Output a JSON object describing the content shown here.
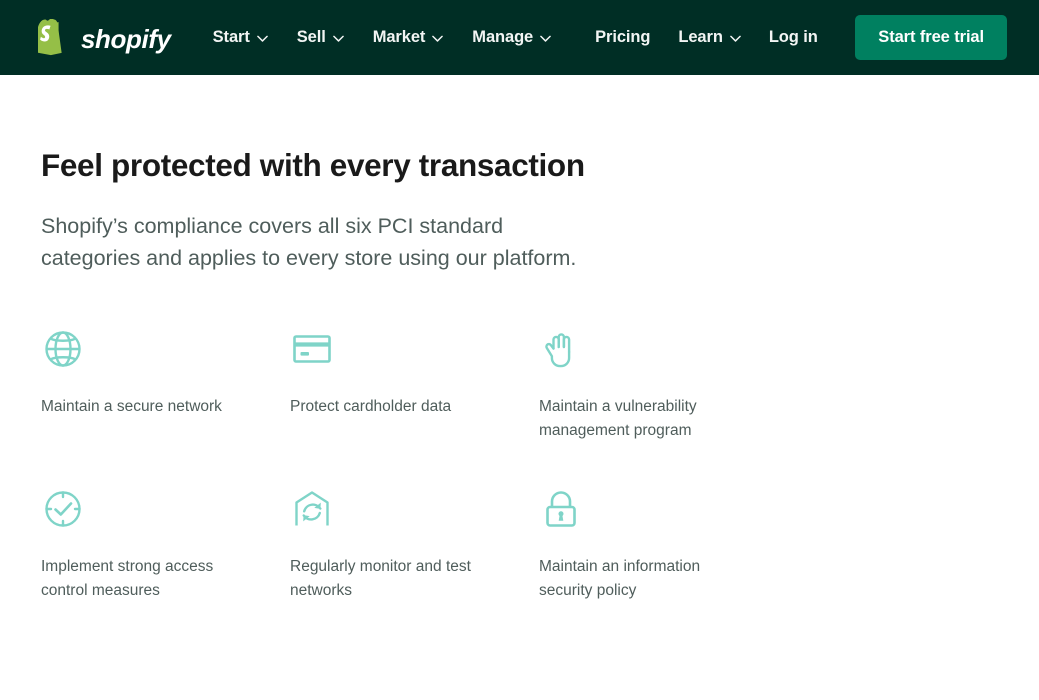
{
  "header": {
    "brand": {
      "name": "shopify",
      "logo_icon": "shopify-bag-icon"
    },
    "primary_nav": [
      {
        "label": "Start",
        "icon": "chevron-down-icon",
        "has_dropdown": true
      },
      {
        "label": "Sell",
        "icon": "chevron-down-icon",
        "has_dropdown": true
      },
      {
        "label": "Market",
        "icon": "chevron-down-icon",
        "has_dropdown": true
      },
      {
        "label": "Manage",
        "icon": "chevron-down-icon",
        "has_dropdown": true
      }
    ],
    "secondary_nav": [
      {
        "label": "Pricing",
        "has_dropdown": false
      },
      {
        "label": "Learn",
        "icon": "chevron-down-icon",
        "has_dropdown": true
      },
      {
        "label": "Log in",
        "has_dropdown": false
      }
    ],
    "cta_label": "Start free trial",
    "colors": {
      "background": "#002e25",
      "cta_background": "#008060",
      "text": "#f2f5f4"
    }
  },
  "main": {
    "headline": "Feel protected with every transaction",
    "lede": "Shopify’s compliance covers all six PCI standard categories and applies to every store using our platform.",
    "pillars": [
      {
        "icon": "globe-icon",
        "label": "Maintain a secure network"
      },
      {
        "icon": "credit-card-icon",
        "label": "Protect cardholder data"
      },
      {
        "icon": "hand-stop-icon",
        "label": "Maintain a vulnerability management program"
      },
      {
        "icon": "check-dial-icon",
        "label": "Implement strong access control measures"
      },
      {
        "icon": "house-refresh-icon",
        "label": "Regularly monitor and test networks"
      },
      {
        "icon": "padlock-icon",
        "label": "Maintain an information security policy"
      }
    ],
    "colors": {
      "heading": "#1a1a1a",
      "body_text": "#4f5d5b",
      "icon": "#7fd4c8",
      "background": "#ffffff"
    }
  }
}
